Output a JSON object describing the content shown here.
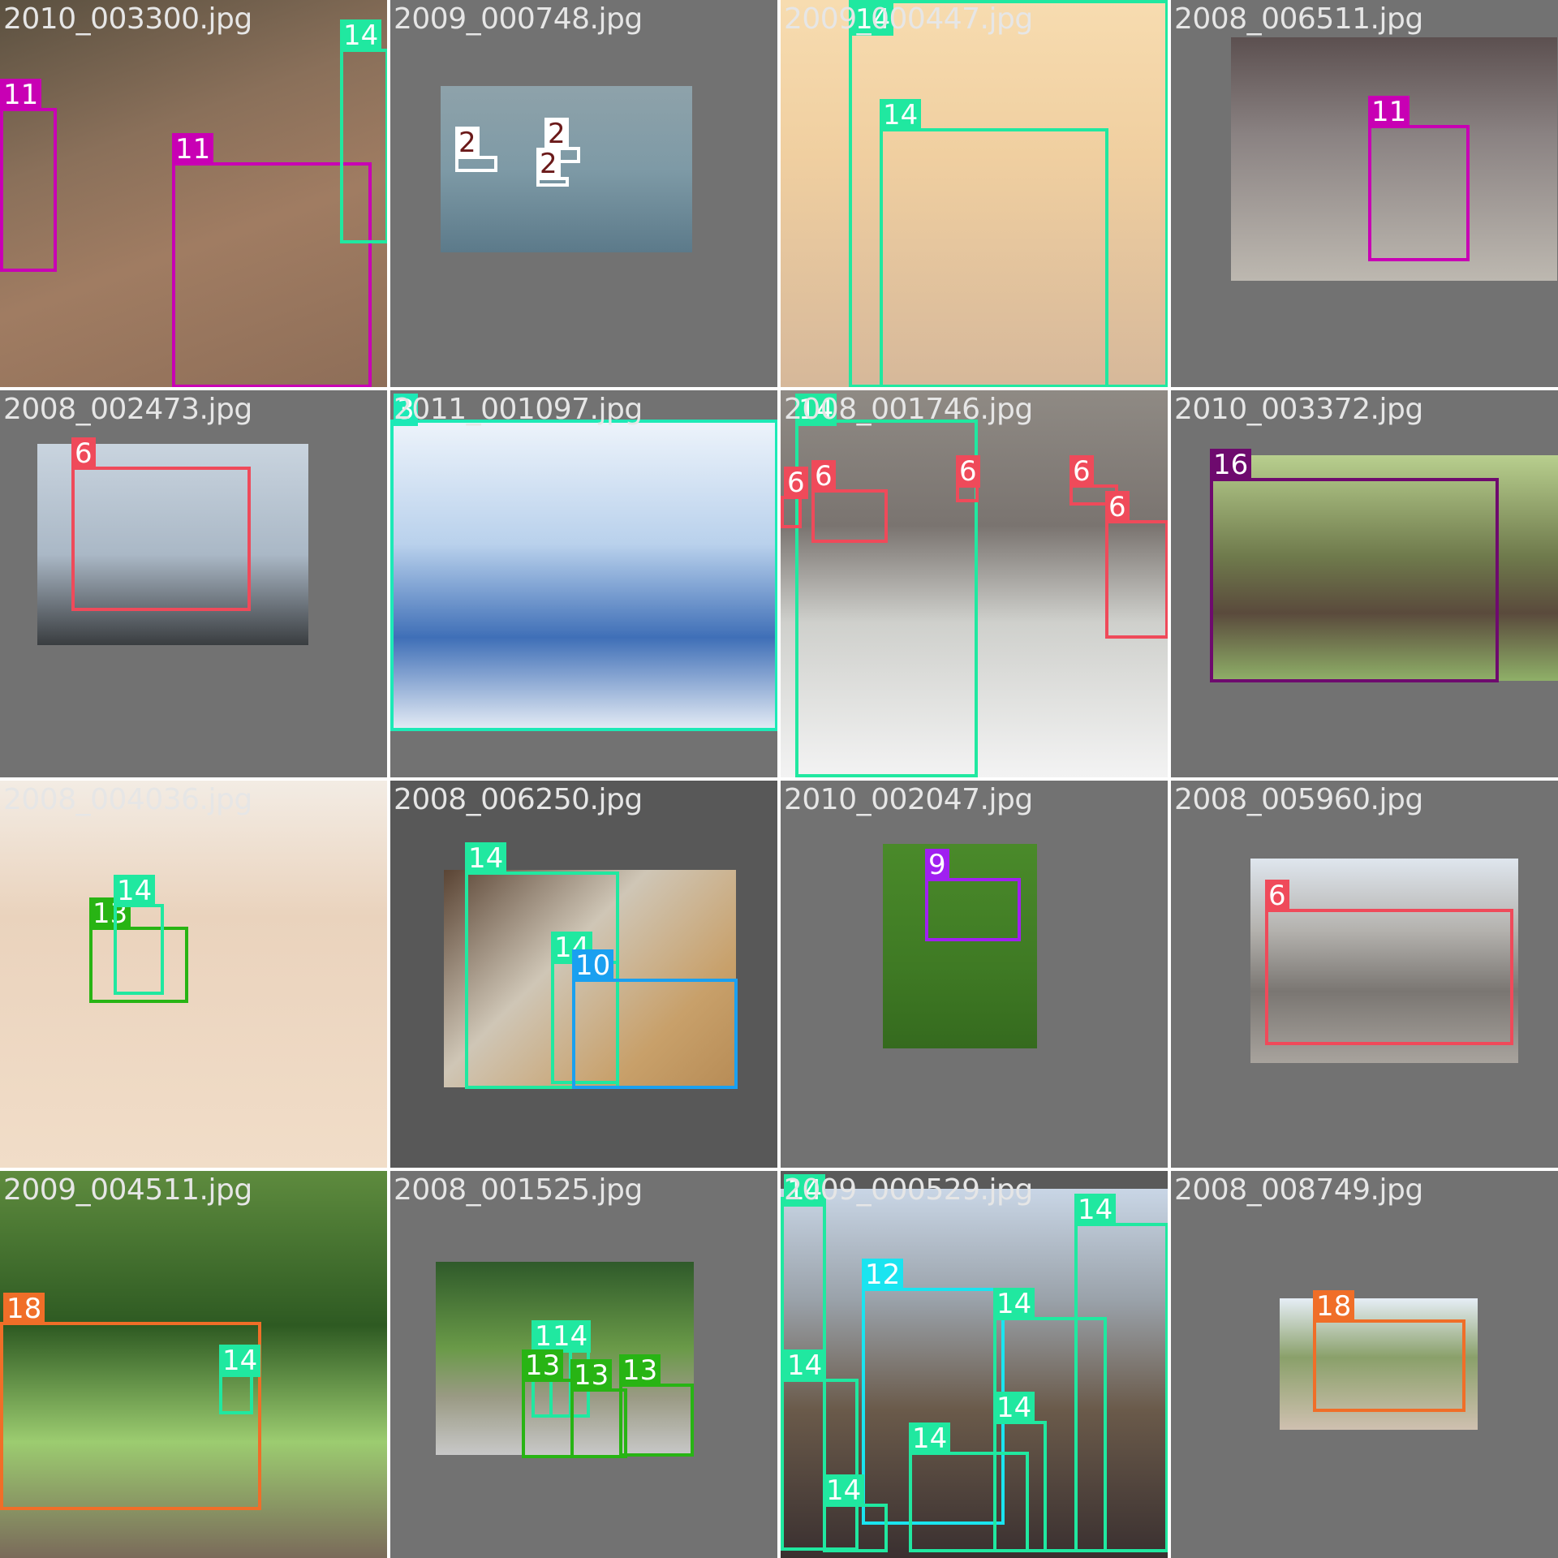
{
  "classColors": {
    "2": "#ffffff",
    "3": "#1de9b6",
    "6": "#ef4a5a",
    "9": "#a020f0",
    "10": "#1aa0f0",
    "11": "#c800b4",
    "12": "#1ae4f0",
    "13": "#28b414",
    "14": "#20e8a0",
    "16": "#6e0a6e",
    "18": "#f06e28"
  },
  "tiles": [
    {
      "filename": "2010_003300.jpg",
      "photo_bg": "linear-gradient(160deg,#5a5040 0%,#8a705a 35%,#a07c62 60%,#8e6e58 100%)",
      "boxes": [
        "11",
        "11",
        "14"
      ]
    },
    {
      "filename": "2009_000748.jpg",
      "photo_bg": "linear-gradient(180deg,#8ea2aa 0%,#7e9aa6 50%,#5c7a8a 100%)",
      "boxes": [
        "2",
        "2",
        "2"
      ]
    },
    {
      "filename": "2009_000447.jpg",
      "photo_bg": "linear-gradient(180deg,#f7dcb0 0%,#f0cfa0 40%,#d6b89a 100%)",
      "boxes": [
        "14",
        "14"
      ]
    },
    {
      "filename": "2008_006511.jpg",
      "photo_bg": "linear-gradient(180deg,#5c5050 0%,#8a8282 40%,#bdb8b0 100%)",
      "boxes": [
        "11"
      ]
    },
    {
      "filename": "2008_002473.jpg",
      "photo_bg": "linear-gradient(180deg,#c9d4df 0%,#aab8c6 55%,#3a3d40 100%)",
      "boxes": [
        "6"
      ]
    },
    {
      "filename": "2011_001097.jpg",
      "photo_bg": "linear-gradient(180deg,#eef4fb 0%,#b9d1ec 40%,#3f6fb7 70%,#e8eef6 100%)",
      "boxes": [
        "3"
      ]
    },
    {
      "filename": "2008_001746.jpg",
      "photo_bg": "linear-gradient(180deg,#8f8a84 0%,#7a7470 35%,#cfd0cc 60%,#f3f3f3 100%)",
      "boxes": [
        "14",
        "6",
        "6",
        "6",
        "6",
        "6"
      ]
    },
    {
      "filename": "2010_003372.jpg",
      "photo_bg": "linear-gradient(180deg,#b8cf8e 0%,#6f7a4c 45%,#5a4a3c 70%,#8fb068 100%)",
      "boxes": [
        "16"
      ]
    },
    {
      "filename": "2008_004036.jpg",
      "photo_bg": "linear-gradient(180deg,#f3ece4 0%,#ead3bd 35%,#f1ddc8 100%)",
      "boxes": [
        "13",
        "14"
      ]
    },
    {
      "filename": "2008_006250.jpg",
      "photo_bg": "linear-gradient(135deg,#5a4434 0%,#cfc6b6 40%,#c8a06a 75%,#b78c56 100%)",
      "boxes": [
        "14",
        "14",
        "10"
      ]
    },
    {
      "filename": "2010_002047.jpg",
      "photo_bg": "linear-gradient(180deg,#4a8a2a 0%,#3f7a24 60%,#356a1e 100%)",
      "boxes": [
        "9"
      ]
    },
    {
      "filename": "2008_005960.jpg",
      "photo_bg": "linear-gradient(180deg,#dfe6ee 0%,#b4b2ae 35%,#7a7672 65%,#a8a39d 100%)",
      "boxes": [
        "6"
      ]
    },
    {
      "filename": "2009_004511.jpg",
      "photo_bg": "linear-gradient(180deg,#5e8b3e 0%,#2e5a22 40%,#9ccc70 70%,#7a6a5a 100%)",
      "boxes": [
        "18",
        "14"
      ]
    },
    {
      "filename": "2008_001525.jpg",
      "photo_bg": "linear-gradient(180deg,#2f5a2a 0%,#6a9a48 45%,#9a9a84 70%,#c8c8c8 100%)",
      "boxes": [
        "14",
        "14",
        "13",
        "13",
        "13"
      ]
    },
    {
      "filename": "2009_000529.jpg",
      "photo_bg": "linear-gradient(180deg,#c9d6e6 0%,#9aa2aa 30%,#6a5a4a 60%,#3a3030 100%)",
      "boxes": [
        "14",
        "12",
        "14",
        "14",
        "14",
        "14",
        "14",
        "14"
      ]
    },
    {
      "filename": "2008_008749.jpg",
      "photo_bg": "linear-gradient(180deg,#e6eef6 0%,#8aa06a 45%,#cfc0b0 100%)",
      "boxes": [
        "18"
      ]
    }
  ]
}
